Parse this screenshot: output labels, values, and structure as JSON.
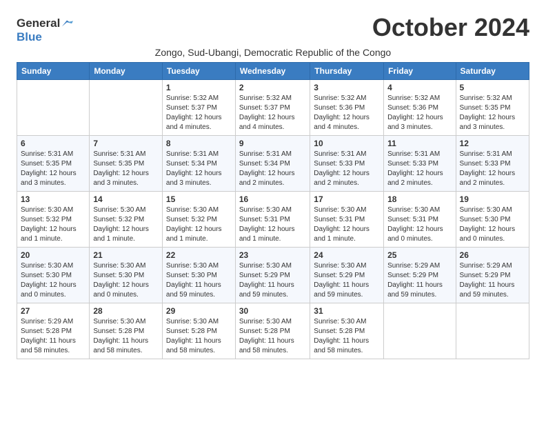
{
  "header": {
    "logo_general": "General",
    "logo_blue": "Blue",
    "month_title": "October 2024",
    "subtitle": "Zongo, Sud-Ubangi, Democratic Republic of the Congo"
  },
  "weekdays": [
    "Sunday",
    "Monday",
    "Tuesday",
    "Wednesday",
    "Thursday",
    "Friday",
    "Saturday"
  ],
  "weeks": [
    [
      {
        "day": "",
        "detail": ""
      },
      {
        "day": "",
        "detail": ""
      },
      {
        "day": "1",
        "detail": "Sunrise: 5:32 AM\nSunset: 5:37 PM\nDaylight: 12 hours\nand 4 minutes."
      },
      {
        "day": "2",
        "detail": "Sunrise: 5:32 AM\nSunset: 5:37 PM\nDaylight: 12 hours\nand 4 minutes."
      },
      {
        "day": "3",
        "detail": "Sunrise: 5:32 AM\nSunset: 5:36 PM\nDaylight: 12 hours\nand 4 minutes."
      },
      {
        "day": "4",
        "detail": "Sunrise: 5:32 AM\nSunset: 5:36 PM\nDaylight: 12 hours\nand 3 minutes."
      },
      {
        "day": "5",
        "detail": "Sunrise: 5:32 AM\nSunset: 5:35 PM\nDaylight: 12 hours\nand 3 minutes."
      }
    ],
    [
      {
        "day": "6",
        "detail": "Sunrise: 5:31 AM\nSunset: 5:35 PM\nDaylight: 12 hours\nand 3 minutes."
      },
      {
        "day": "7",
        "detail": "Sunrise: 5:31 AM\nSunset: 5:35 PM\nDaylight: 12 hours\nand 3 minutes."
      },
      {
        "day": "8",
        "detail": "Sunrise: 5:31 AM\nSunset: 5:34 PM\nDaylight: 12 hours\nand 3 minutes."
      },
      {
        "day": "9",
        "detail": "Sunrise: 5:31 AM\nSunset: 5:34 PM\nDaylight: 12 hours\nand 2 minutes."
      },
      {
        "day": "10",
        "detail": "Sunrise: 5:31 AM\nSunset: 5:33 PM\nDaylight: 12 hours\nand 2 minutes."
      },
      {
        "day": "11",
        "detail": "Sunrise: 5:31 AM\nSunset: 5:33 PM\nDaylight: 12 hours\nand 2 minutes."
      },
      {
        "day": "12",
        "detail": "Sunrise: 5:31 AM\nSunset: 5:33 PM\nDaylight: 12 hours\nand 2 minutes."
      }
    ],
    [
      {
        "day": "13",
        "detail": "Sunrise: 5:30 AM\nSunset: 5:32 PM\nDaylight: 12 hours\nand 1 minute."
      },
      {
        "day": "14",
        "detail": "Sunrise: 5:30 AM\nSunset: 5:32 PM\nDaylight: 12 hours\nand 1 minute."
      },
      {
        "day": "15",
        "detail": "Sunrise: 5:30 AM\nSunset: 5:32 PM\nDaylight: 12 hours\nand 1 minute."
      },
      {
        "day": "16",
        "detail": "Sunrise: 5:30 AM\nSunset: 5:31 PM\nDaylight: 12 hours\nand 1 minute."
      },
      {
        "day": "17",
        "detail": "Sunrise: 5:30 AM\nSunset: 5:31 PM\nDaylight: 12 hours\nand 1 minute."
      },
      {
        "day": "18",
        "detail": "Sunrise: 5:30 AM\nSunset: 5:31 PM\nDaylight: 12 hours\nand 0 minutes."
      },
      {
        "day": "19",
        "detail": "Sunrise: 5:30 AM\nSunset: 5:30 PM\nDaylight: 12 hours\nand 0 minutes."
      }
    ],
    [
      {
        "day": "20",
        "detail": "Sunrise: 5:30 AM\nSunset: 5:30 PM\nDaylight: 12 hours\nand 0 minutes."
      },
      {
        "day": "21",
        "detail": "Sunrise: 5:30 AM\nSunset: 5:30 PM\nDaylight: 12 hours\nand 0 minutes."
      },
      {
        "day": "22",
        "detail": "Sunrise: 5:30 AM\nSunset: 5:30 PM\nDaylight: 11 hours\nand 59 minutes."
      },
      {
        "day": "23",
        "detail": "Sunrise: 5:30 AM\nSunset: 5:29 PM\nDaylight: 11 hours\nand 59 minutes."
      },
      {
        "day": "24",
        "detail": "Sunrise: 5:30 AM\nSunset: 5:29 PM\nDaylight: 11 hours\nand 59 minutes."
      },
      {
        "day": "25",
        "detail": "Sunrise: 5:29 AM\nSunset: 5:29 PM\nDaylight: 11 hours\nand 59 minutes."
      },
      {
        "day": "26",
        "detail": "Sunrise: 5:29 AM\nSunset: 5:29 PM\nDaylight: 11 hours\nand 59 minutes."
      }
    ],
    [
      {
        "day": "27",
        "detail": "Sunrise: 5:29 AM\nSunset: 5:28 PM\nDaylight: 11 hours\nand 58 minutes."
      },
      {
        "day": "28",
        "detail": "Sunrise: 5:30 AM\nSunset: 5:28 PM\nDaylight: 11 hours\nand 58 minutes."
      },
      {
        "day": "29",
        "detail": "Sunrise: 5:30 AM\nSunset: 5:28 PM\nDaylight: 11 hours\nand 58 minutes."
      },
      {
        "day": "30",
        "detail": "Sunrise: 5:30 AM\nSunset: 5:28 PM\nDaylight: 11 hours\nand 58 minutes."
      },
      {
        "day": "31",
        "detail": "Sunrise: 5:30 AM\nSunset: 5:28 PM\nDaylight: 11 hours\nand 58 minutes."
      },
      {
        "day": "",
        "detail": ""
      },
      {
        "day": "",
        "detail": ""
      }
    ]
  ]
}
